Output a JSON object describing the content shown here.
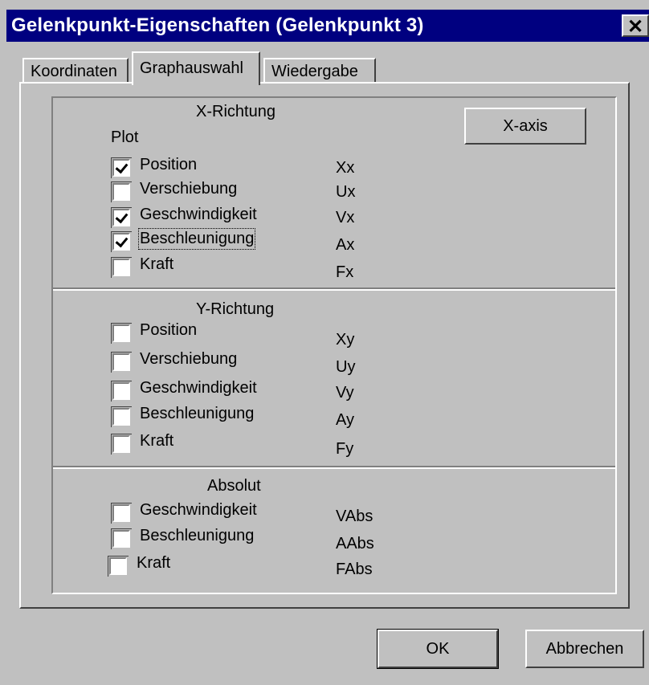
{
  "window": {
    "title": "Gelenkpunkt-Eigenschaften (Gelenkpunkt 3)",
    "close_glyph": "✕"
  },
  "tabs": [
    {
      "label": "Koordinaten",
      "active": false
    },
    {
      "label": "Graphauswahl",
      "active": true
    },
    {
      "label": "Wiedergabe",
      "active": false
    }
  ],
  "x_section": {
    "title": "X-Richtung",
    "plot_label": "Plot",
    "axis_button": "X-axis",
    "items": [
      {
        "label": "Position",
        "code": "Xx",
        "checked": true
      },
      {
        "label": "Verschiebung",
        "code": "Ux",
        "checked": false
      },
      {
        "label": "Geschwindigkeit",
        "code": "Vx",
        "checked": true
      },
      {
        "label": "Beschleunigung",
        "code": "Ax",
        "checked": true
      },
      {
        "label": "Kraft",
        "code": "Fx",
        "checked": false
      }
    ]
  },
  "y_section": {
    "title": "Y-Richtung",
    "items": [
      {
        "label": "Position",
        "code": "Xy",
        "checked": false
      },
      {
        "label": "Verschiebung",
        "code": "Uy",
        "checked": false
      },
      {
        "label": "Geschwindigkeit",
        "code": "Vy",
        "checked": false
      },
      {
        "label": "Beschleunigung",
        "code": "Ay",
        "checked": false
      },
      {
        "label": "Kraft",
        "code": "Fy",
        "checked": false
      }
    ]
  },
  "abs_section": {
    "title": "Absolut",
    "items": [
      {
        "label": "Geschwindigkeit",
        "code": "VAbs",
        "checked": false
      },
      {
        "label": "Beschleunigung",
        "code": "AAbs",
        "checked": false
      },
      {
        "label": "Kraft",
        "code": "FAbs",
        "checked": false
      }
    ]
  },
  "buttons": {
    "ok": "OK",
    "cancel": "Abbrechen"
  }
}
